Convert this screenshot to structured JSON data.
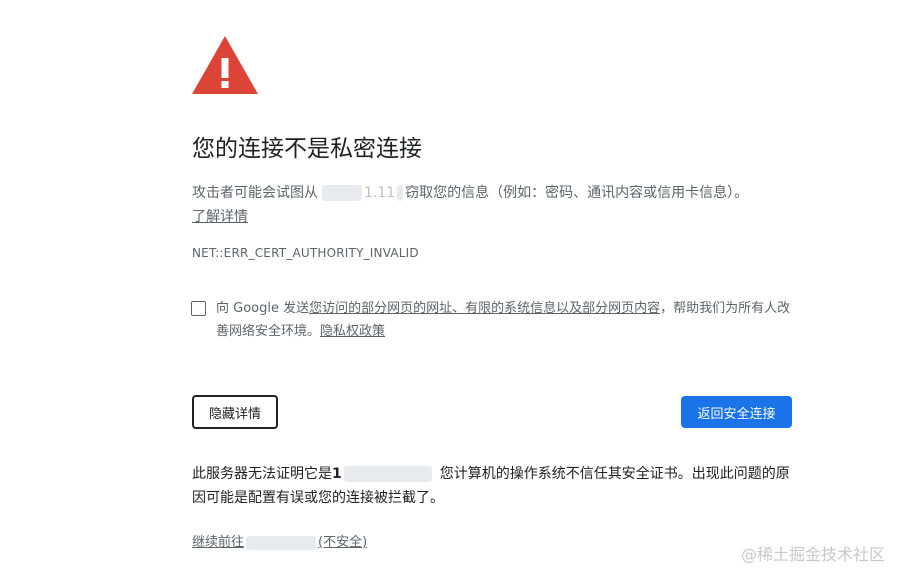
{
  "interstitial": {
    "title": "您的连接不是私密连接",
    "description_before": "攻击者可能会试图从",
    "description_host_fragment": "1.11",
    "description_after": "窃取您的信息（例如：密码、通讯内容或信用卡信息）。",
    "learn_more": "了解详情",
    "error_code": "NET::ERR_CERT_AUTHORITY_INVALID"
  },
  "safe_browsing": {
    "prefix": "向 Google 发送",
    "link_data": "您访问的部分网页的网址、有限的系统信息以及部分网页内容",
    "middle": "，帮助我们为所有人改善网络安全环境。",
    "privacy_link": "隐私权政策",
    "checked": false
  },
  "buttons": {
    "hide_details": "隐藏详情",
    "back_to_safety": "返回安全连接"
  },
  "details": {
    "before": "此服务器无法证明它是",
    "host_fragment": "1",
    "after": "您计算机的操作系统不信任其安全证书。出现此问题的原因可能是配置有误或您的连接被拦截了。"
  },
  "proceed": {
    "before": "继续前往",
    "after": "(不安全)"
  },
  "watermark": "@稀土掘金技术社区",
  "colors": {
    "warning_red": "#dc4437",
    "primary_blue": "#1a73e8",
    "text_secondary": "#5f6368",
    "text_primary": "#202124"
  },
  "icons": {
    "warning": "warning-triangle-icon"
  }
}
